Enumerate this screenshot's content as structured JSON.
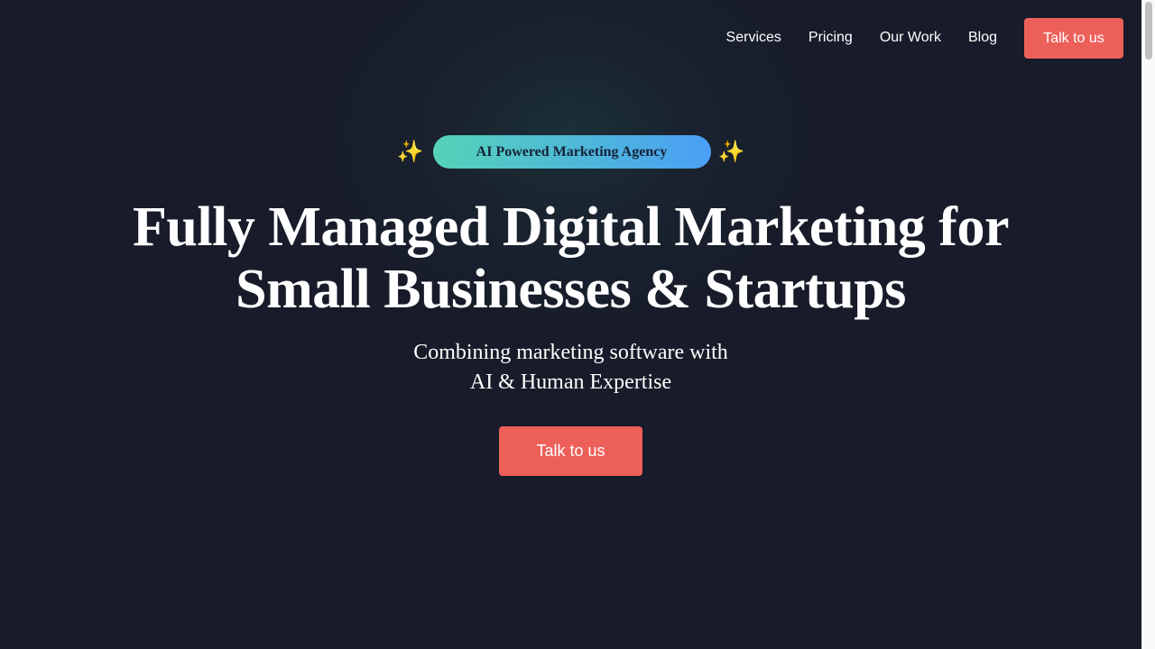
{
  "nav": {
    "items": [
      {
        "label": "Services"
      },
      {
        "label": "Pricing"
      },
      {
        "label": "Our Work"
      },
      {
        "label": "Blog"
      }
    ],
    "cta_label": "Talk to us"
  },
  "hero": {
    "badge": {
      "label": "AI Powered Marketing Agency",
      "left_icon": "✨",
      "right_icon": "✨"
    },
    "headline_line1": "Fully Managed Digital Marketing for",
    "headline_line2": "Small Businesses & Startups",
    "subhead_line1": "Combining marketing software with",
    "subhead_line2": "AI & Human Expertise",
    "cta_label": "Talk to us"
  },
  "colors": {
    "background": "#181b29",
    "accent": "#ed605a",
    "badge_gradient_start": "#55d3b8",
    "badge_gradient_end": "#4a9ff5",
    "text": "#ffffff"
  }
}
